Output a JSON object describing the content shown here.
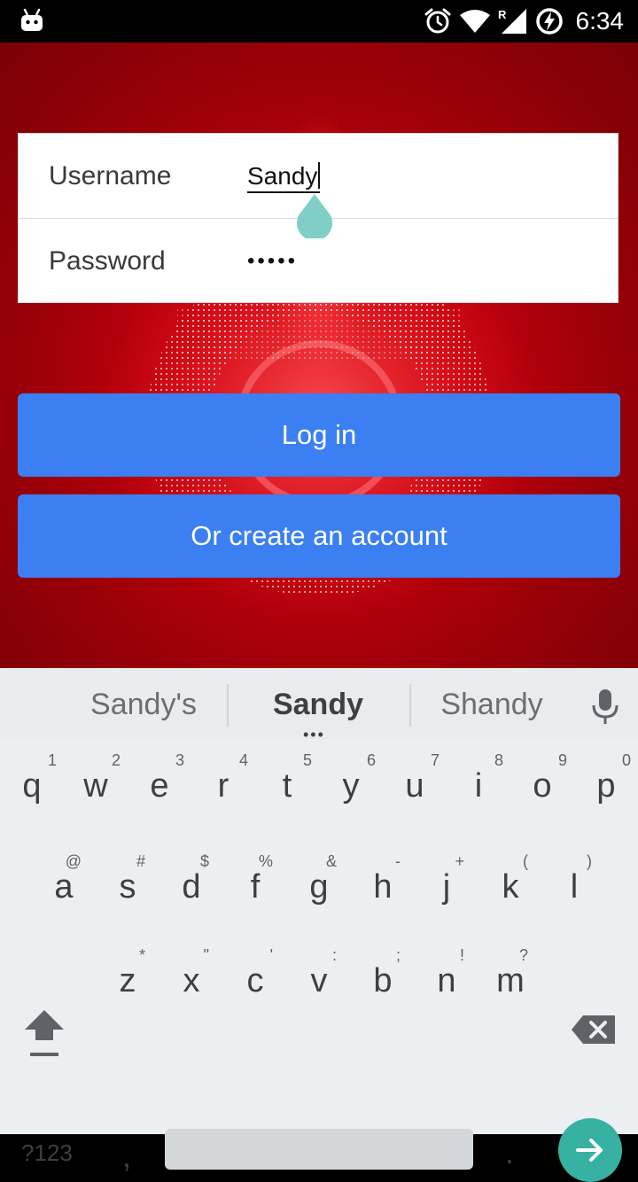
{
  "status_bar": {
    "time": "6:34",
    "icons": [
      "android-icon",
      "alarm-icon",
      "wifi-icon",
      "signal-roaming-icon",
      "battery-charging-icon"
    ],
    "roaming_label": "R"
  },
  "login": {
    "username_label": "Username",
    "username_value": "Sandy",
    "password_label": "Password",
    "password_value": "•••••",
    "login_button": "Log in",
    "create_button": "Or create an account"
  },
  "keyboard": {
    "suggestions": [
      "Sandy's",
      "Sandy",
      "Shandy"
    ],
    "row1": [
      {
        "k": "q",
        "h": "1"
      },
      {
        "k": "w",
        "h": "2"
      },
      {
        "k": "e",
        "h": "3"
      },
      {
        "k": "r",
        "h": "4"
      },
      {
        "k": "t",
        "h": "5"
      },
      {
        "k": "y",
        "h": "6"
      },
      {
        "k": "u",
        "h": "7"
      },
      {
        "k": "i",
        "h": "8"
      },
      {
        "k": "o",
        "h": "9"
      },
      {
        "k": "p",
        "h": "0"
      }
    ],
    "row2": [
      {
        "k": "a",
        "h": "@"
      },
      {
        "k": "s",
        "h": "#"
      },
      {
        "k": "d",
        "h": "$"
      },
      {
        "k": "f",
        "h": "%"
      },
      {
        "k": "g",
        "h": "&"
      },
      {
        "k": "h",
        "h": "-"
      },
      {
        "k": "j",
        "h": "+"
      },
      {
        "k": "k",
        "h": "("
      },
      {
        "k": "l",
        "h": ")"
      }
    ],
    "row3": [
      {
        "k": "z",
        "h": "*"
      },
      {
        "k": "x",
        "h": "\""
      },
      {
        "k": "c",
        "h": "'"
      },
      {
        "k": "v",
        "h": ":"
      },
      {
        "k": "b",
        "h": ";"
      },
      {
        "k": "n",
        "h": "!"
      },
      {
        "k": "m",
        "h": "?"
      }
    ],
    "symbols_key": "?123",
    "comma_key": ",",
    "period_key": "."
  },
  "colors": {
    "accent_button": "#3b7ff2",
    "enter_key": "#37b2a2",
    "background_red": "#c0000c",
    "text_handle": "#7fcfc6"
  }
}
